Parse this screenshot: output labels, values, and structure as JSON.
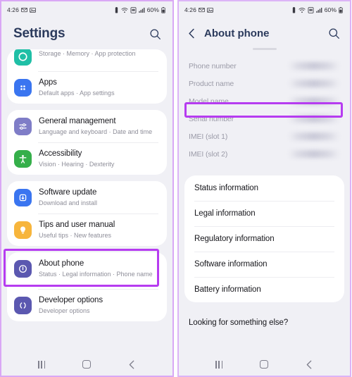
{
  "meta": {
    "accent_highlight": "#b63cf0",
    "title_color": "#2b3a5c",
    "screen_bg": "#f0f0f5",
    "card_bg": "#ffffff"
  },
  "status_bar": {
    "time": "4:26",
    "battery_percent": "60%",
    "left_icons": [
      "messaging-icon",
      "image-icon"
    ],
    "right_icons": [
      "alarm-icon",
      "wifi-icon",
      "sim-icon",
      "signal-icon",
      "battery-icon"
    ]
  },
  "left_screen": {
    "header": {
      "title": "Settings",
      "search_icon": "search-icon"
    },
    "groups": [
      {
        "items": [
          {
            "title": "",
            "subtitle": "Storage  ·  Memory  ·  App protection",
            "icon": "device-care-icon",
            "icon_color": "#1fbfa6",
            "clipped": true
          },
          {
            "title": "Apps",
            "subtitle": "Default apps  ·  App settings",
            "icon": "apps-grid-icon",
            "icon_color": "#3a75f0"
          }
        ]
      },
      {
        "items": [
          {
            "title": "General management",
            "subtitle": "Language and keyboard  ·  Date and time",
            "icon": "sliders-icon",
            "icon_color": "#7f7dc7"
          },
          {
            "title": "Accessibility",
            "subtitle": "Vision  ·  Hearing  ·  Dexterity",
            "icon": "accessibility-icon",
            "icon_color": "#35af4a"
          }
        ]
      },
      {
        "items": [
          {
            "title": "Software update",
            "subtitle": "Download and install",
            "icon": "software-update-icon",
            "icon_color": "#3a75f0"
          },
          {
            "title": "Tips and user manual",
            "subtitle": "Useful tips  ·  New features",
            "icon": "lightbulb-icon",
            "icon_color": "#f7b53c"
          }
        ]
      },
      {
        "items": [
          {
            "title": "About phone",
            "subtitle": "Status  ·  Legal information  ·  Phone name",
            "icon": "info-circle-icon",
            "icon_color": "#5b58b0",
            "highlighted": true
          },
          {
            "title": "Developer options",
            "subtitle": "Developer options",
            "icon": "developer-brackets-icon",
            "icon_color": "#5b58b0"
          }
        ]
      }
    ]
  },
  "right_screen": {
    "header": {
      "back_icon": "chevron-left-icon",
      "title": "About phone",
      "search_icon": "search-icon"
    },
    "info_rows": [
      {
        "label": "Phone number",
        "value_hidden": true
      },
      {
        "label": "Product name",
        "value_hidden": true
      },
      {
        "label": "Model name",
        "value_hidden": true,
        "highlighted": true
      },
      {
        "label": "Serial number",
        "value_hidden": true
      },
      {
        "label": "IMEI (slot 1)",
        "value_hidden": true
      },
      {
        "label": "IMEI (slot 2)",
        "value_hidden": true
      }
    ],
    "menu_rows": [
      "Status information",
      "Legal information",
      "Regulatory information",
      "Software information",
      "Battery information"
    ],
    "footer_prompt": "Looking for something else?"
  },
  "nav_bar": {
    "recents_label": "recents-button",
    "home_label": "home-button",
    "back_label": "back-button"
  }
}
